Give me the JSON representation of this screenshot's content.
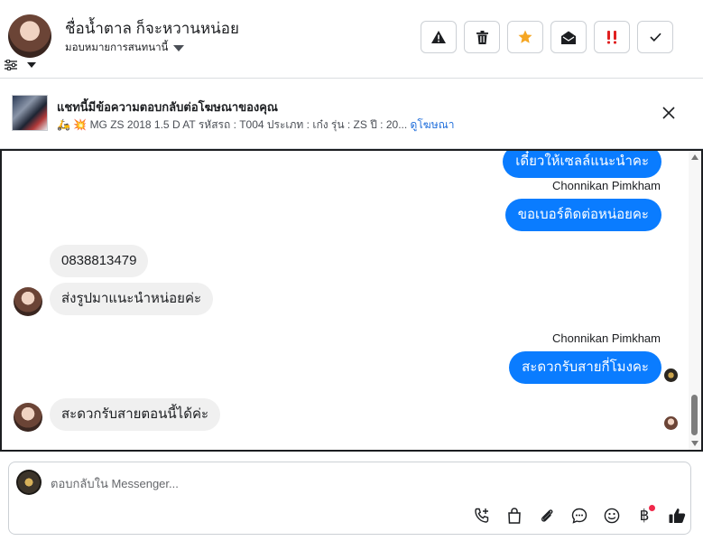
{
  "header": {
    "contact_name": "ชื่อน้ำตาล ก็จะหวานหน่อย",
    "assign_label": "มอบหมายการสนทนานี้",
    "actions": [
      {
        "name": "warning-icon",
        "color": "#1c1e21"
      },
      {
        "name": "trash-icon",
        "color": "#1c1e21"
      },
      {
        "name": "star-icon",
        "color": "#f5a623"
      },
      {
        "name": "envelope-open-icon",
        "color": "#1c1e21"
      },
      {
        "name": "double-exclamation-icon",
        "color": "#e02020"
      },
      {
        "name": "check-icon",
        "color": "#1c1e21"
      }
    ]
  },
  "banner": {
    "title": "แชทนี้มีข้อความตอบกลับต่อโฆษณาของคุณ",
    "emojis": "🛵 💥",
    "subtitle": "MG ZS 2018 1.5 D AT รหัสรถ : T004 ประเภท : เก๋ง รุ่น : ZS ปี : 20...",
    "link": "ดูโฆษณา"
  },
  "messages": {
    "out_1": "เดี๋ยวให้เซลล์แนะนำคะ",
    "sender_1": "Chonnikan Pimkham",
    "out_2": "ขอเบอร์ติดต่อหน่อยคะ",
    "in_1": "0838813479",
    "in_2": "ส่งรูปมาแนะนำหน่อยค่ะ",
    "sender_2": "Chonnikan Pimkham",
    "out_3": "สะดวกรับสายกี่โมงคะ",
    "in_3": "สะดวกรับสายตอนนี้ได้ค่ะ"
  },
  "composer": {
    "placeholder": "ตอบกลับใน Messenger...",
    "baht_symbol": "฿",
    "tools": [
      "phone-plus-icon",
      "shopping-bag-icon",
      "paperclip-icon",
      "chat-bubble-icon",
      "smiley-icon",
      "baht-icon",
      "thumbs-up-icon"
    ]
  },
  "colors": {
    "outgoing_bubble": "#0a7cff",
    "incoming_bubble": "#f0f0f0",
    "link": "#216fdb"
  }
}
